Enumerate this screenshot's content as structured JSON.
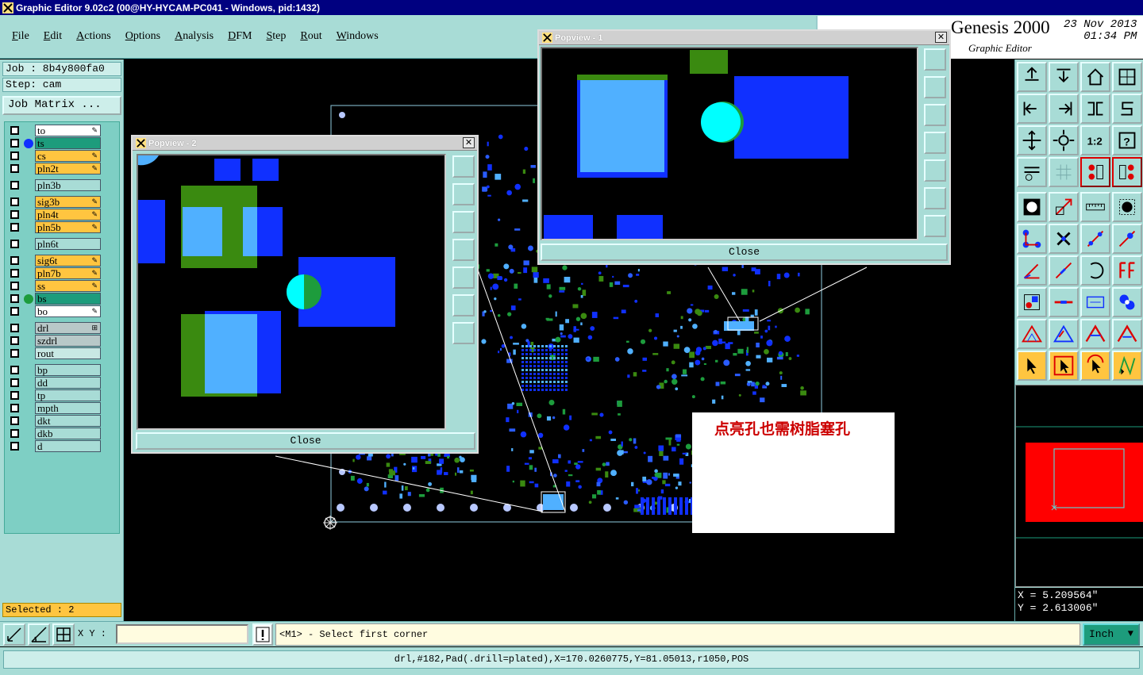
{
  "window": {
    "title": "Graphic Editor 9.02c2 (00@HY-HYCAM-PC041 - Windows, pid:1432)"
  },
  "menu": [
    "File",
    "Edit",
    "Actions",
    "Options",
    "Analysis",
    "DFM",
    "Step",
    "Rout",
    "Windows"
  ],
  "brand": {
    "name": "Genesis 2000",
    "subtitle": "Graphic Editor",
    "date": "23 Nov 2013",
    "time": "01:34 PM"
  },
  "job": {
    "job_line": "Job : 8b4y800fa0",
    "step_line": "Step: cam",
    "matrix_label": "Job Matrix ..."
  },
  "layers": [
    {
      "name": "to",
      "style": "sel",
      "dot": "",
      "mark": "✎"
    },
    {
      "name": "ts",
      "style": "green",
      "dot": "#1030ff",
      "mark": ""
    },
    {
      "name": "cs",
      "style": "board",
      "dot": "",
      "mark": "✎"
    },
    {
      "name": "pln2t",
      "style": "board",
      "dot": "",
      "mark": "✎"
    },
    {
      "name": "pln3b",
      "style": "plain",
      "dot": "",
      "mark": ""
    },
    {
      "name": "sig3b",
      "style": "board",
      "dot": "",
      "mark": "✎"
    },
    {
      "name": "pln4t",
      "style": "board",
      "dot": "",
      "mark": "✎"
    },
    {
      "name": "pln5b",
      "style": "board",
      "dot": "",
      "mark": "✎"
    },
    {
      "name": "pln6t",
      "style": "plain",
      "dot": "",
      "mark": ""
    },
    {
      "name": "sig6t",
      "style": "board",
      "dot": "",
      "mark": "✎"
    },
    {
      "name": "pln7b",
      "style": "board",
      "dot": "",
      "mark": "✎"
    },
    {
      "name": "ss",
      "style": "board",
      "dot": "",
      "mark": "✎"
    },
    {
      "name": "bs",
      "style": "green",
      "dot": "#1d9c3c",
      "mark": ""
    },
    {
      "name": "bo",
      "style": "sel",
      "dot": "",
      "mark": "✎"
    },
    {
      "name": "drl",
      "style": "grey",
      "dot": "",
      "mark": "⊞"
    },
    {
      "name": "szdrl",
      "style": "grey",
      "dot": "",
      "mark": ""
    },
    {
      "name": "rout",
      "style": "misc",
      "dot": "",
      "mark": ""
    },
    {
      "name": "bp",
      "style": "plain",
      "dot": "",
      "mark": ""
    },
    {
      "name": "dd",
      "style": "plain",
      "dot": "",
      "mark": ""
    },
    {
      "name": "tp",
      "style": "plain",
      "dot": "",
      "mark": ""
    },
    {
      "name": "mpth",
      "style": "plain",
      "dot": "",
      "mark": ""
    },
    {
      "name": "dkt",
      "style": "plain",
      "dot": "",
      "mark": ""
    },
    {
      "name": "dkb",
      "style": "plain",
      "dot": "",
      "mark": ""
    },
    {
      "name": "d",
      "style": "plain",
      "dot": "",
      "mark": ""
    }
  ],
  "selected_label": "Selected : 2",
  "popview1": {
    "title": "Popview - 1",
    "close_label": "Close"
  },
  "popview2": {
    "title": "Popview - 2",
    "close_label": "Close"
  },
  "annotation": {
    "text": "点亮孔也需树脂塞孔"
  },
  "coords": {
    "x_line": "X = 5.209564\"",
    "y_line": "Y = 2.613006\""
  },
  "command": {
    "xy_label": "X Y :",
    "xy_value": "",
    "prompt": "<M1> - Select first corner",
    "unit": "Inch"
  },
  "status": {
    "text": "drl,#182,Pad(.drill=plated),X=170.0260775,Y=81.05013,r1050,POS"
  },
  "colors": {
    "panel": "#a8dcd6",
    "board_layer": "#ffc540",
    "copper": "#1030ff",
    "pad": "#50b0ff",
    "soldermask": "#3a8a10",
    "drill_hit": "#00ffff",
    "annotation_text": "#cc0000"
  }
}
